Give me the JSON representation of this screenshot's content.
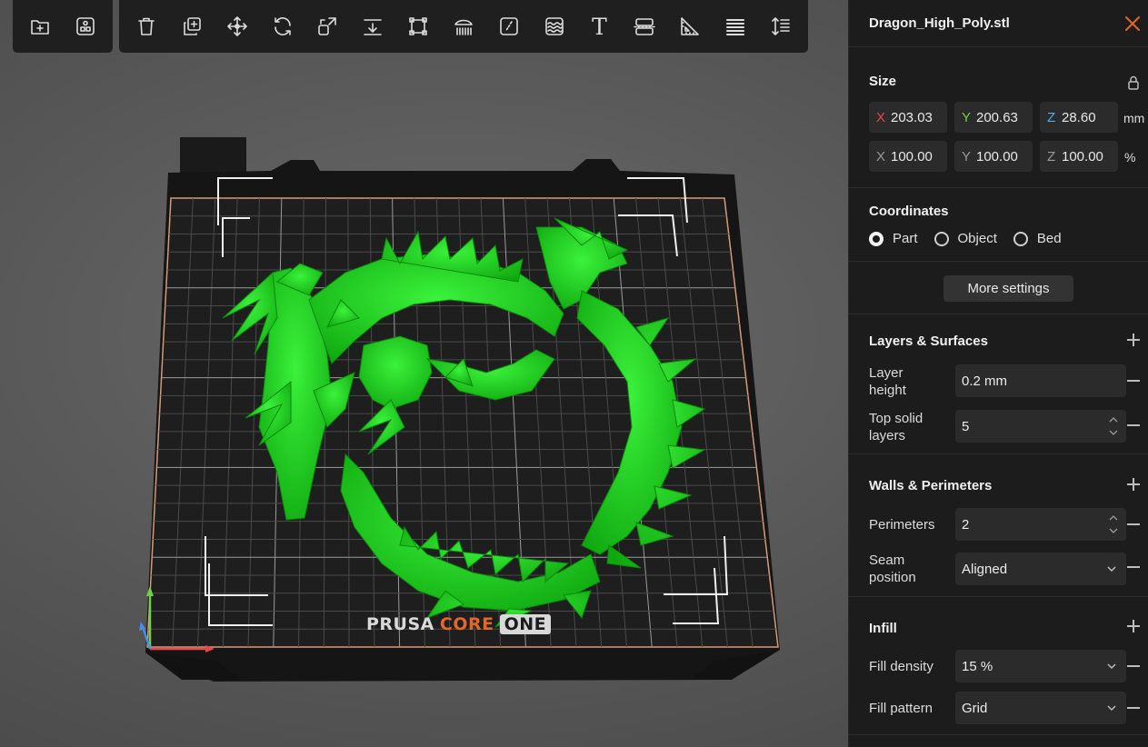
{
  "toolbar_left": {
    "items": [
      {
        "icon": "add-object-icon"
      },
      {
        "icon": "arrange-icon"
      }
    ]
  },
  "toolbar_main": {
    "items": [
      {
        "icon": "delete-icon"
      },
      {
        "icon": "duplicate-icon"
      },
      {
        "icon": "move-icon"
      },
      {
        "icon": "rotate-icon"
      },
      {
        "icon": "scale-icon"
      },
      {
        "icon": "place-on-face-icon"
      },
      {
        "icon": "cut-icon"
      },
      {
        "icon": "supports-paint-icon"
      },
      {
        "icon": "seam-paint-icon"
      },
      {
        "icon": "fuzzy-skin-icon"
      },
      {
        "icon": "text-icon"
      },
      {
        "icon": "split-icon"
      },
      {
        "icon": "measure-icon"
      },
      {
        "icon": "layers-icon"
      },
      {
        "icon": "height-range-icon"
      }
    ],
    "text_glyph": "T"
  },
  "bed_logo": {
    "part1": "PRUSA",
    "part2": "CORE",
    "part3": "ONE"
  },
  "panel": {
    "file_name": "Dragon_High_Poly.stl",
    "size": {
      "title": "Size",
      "mm_row": {
        "x": "203.03",
        "y": "200.63",
        "z": "28.60",
        "unit": "mm"
      },
      "pct_row": {
        "x": "100.00",
        "y": "100.00",
        "z": "100.00",
        "unit": "%"
      },
      "axis_labels": {
        "x": "X",
        "y": "Y",
        "z": "Z"
      }
    },
    "coordinates": {
      "title": "Coordinates",
      "options": [
        "Part",
        "Object",
        "Bed"
      ],
      "selected": "Part"
    },
    "more_settings": "More settings",
    "layers": {
      "title": "Layers & Surfaces",
      "layer_height_label": "Layer\nheight",
      "layer_height_value": "0.2 mm",
      "top_solid_label": "Top solid\nlayers",
      "top_solid_value": "5"
    },
    "walls": {
      "title": "Walls & Perimeters",
      "perimeters_label": "Perimeters",
      "perimeters_value": "2",
      "seam_label": "Seam\nposition",
      "seam_value": "Aligned"
    },
    "infill": {
      "title": "Infill",
      "density_label": "Fill density",
      "density_value": "15 %",
      "pattern_label": "Fill pattern",
      "pattern_value": "Grid"
    }
  },
  "colors": {
    "model": "#16d216",
    "accent_close": "#e2672a",
    "axis_x": "#e8484a",
    "axis_y": "#6fd14a",
    "axis_z": "#4a8de8"
  }
}
